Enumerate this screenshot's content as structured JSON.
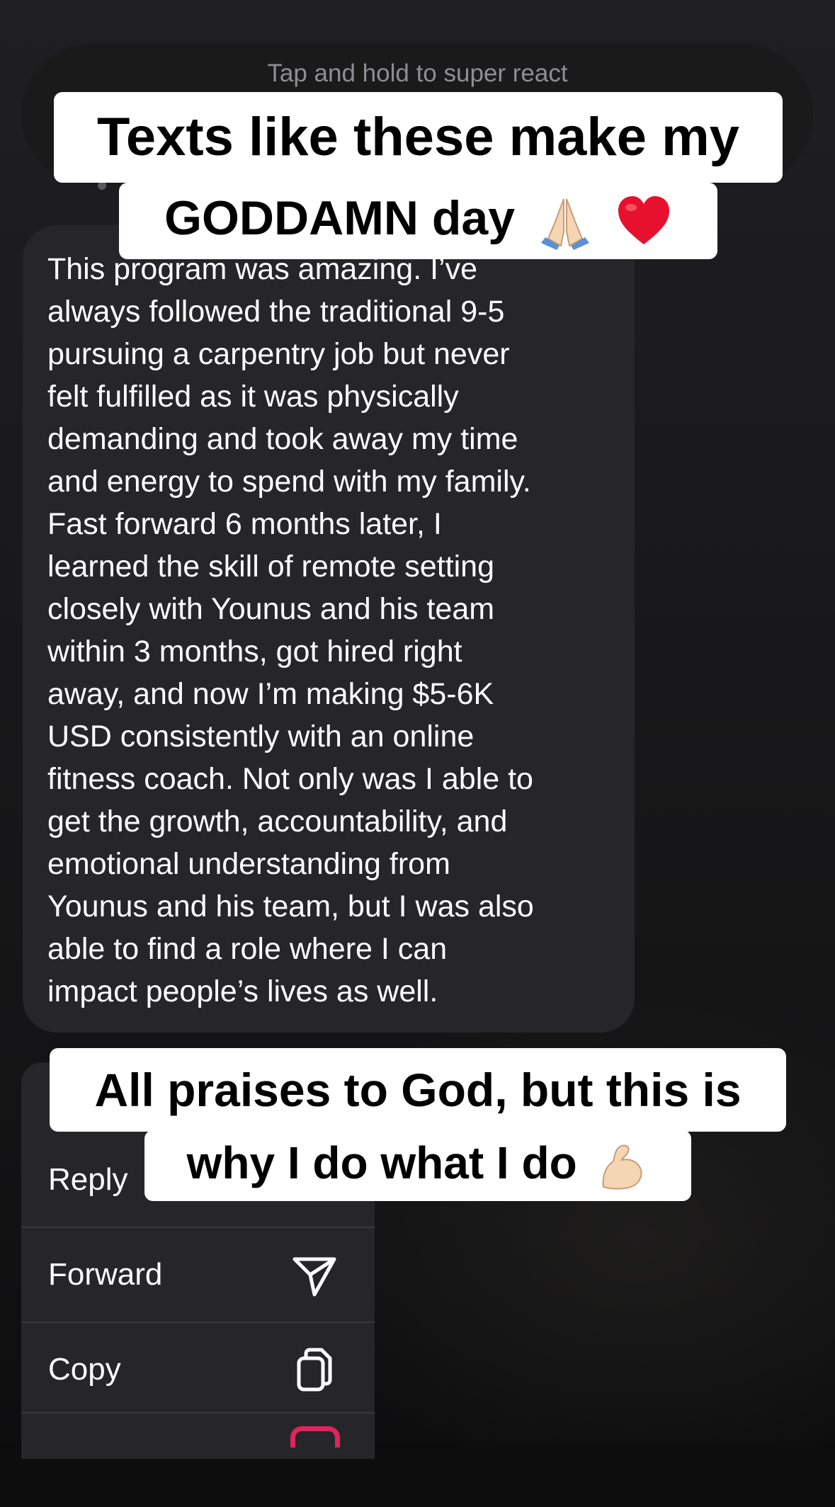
{
  "react_bar": {
    "hint": "Tap and hold to super react"
  },
  "message": {
    "text": "This program was amazing. I’ve\nalways followed the traditional 9-5\npursuing a carpentry job but never\nfelt fulfilled as it was physically\ndemanding and took away my time\nand energy to spend with my family.\nFast forward 6 months later, I\nlearned the skill of remote setting\nclosely with Younus and his team\nwithin 3 months, got hired right\naway, and now I’m making $5-6K\nUSD consistently with an online\nfitness coach. Not only was I able to\nget the growth, accountability, and\nemotional understanding from\nYounus and his team, but I was also\nable to find a role where I can\nimpact people’s lives as well."
  },
  "overlay_captions": {
    "top_line1": "Texts like these make my",
    "top_line2": "GODDAMN day",
    "top_emoji_1": "praying-hands",
    "top_emoji_2": "red-heart",
    "bottom_line1": "All praises to God, but this is",
    "bottom_line2": "why I do what I do",
    "bottom_emoji": "flexed-biceps"
  },
  "context_menu": {
    "items": [
      {
        "label": "Reply",
        "icon": "reply-icon"
      },
      {
        "label": "Forward",
        "icon": "paper-plane-icon"
      },
      {
        "label": "Copy",
        "icon": "copy-icon"
      },
      {
        "label": "",
        "icon": "partially-visible-icon"
      }
    ]
  },
  "colors": {
    "background": "#141415",
    "bubble": "#262628",
    "caption_bg": "#ffffff",
    "hint_text": "#8e8e93",
    "next_icon_accent": "#e0245e"
  }
}
